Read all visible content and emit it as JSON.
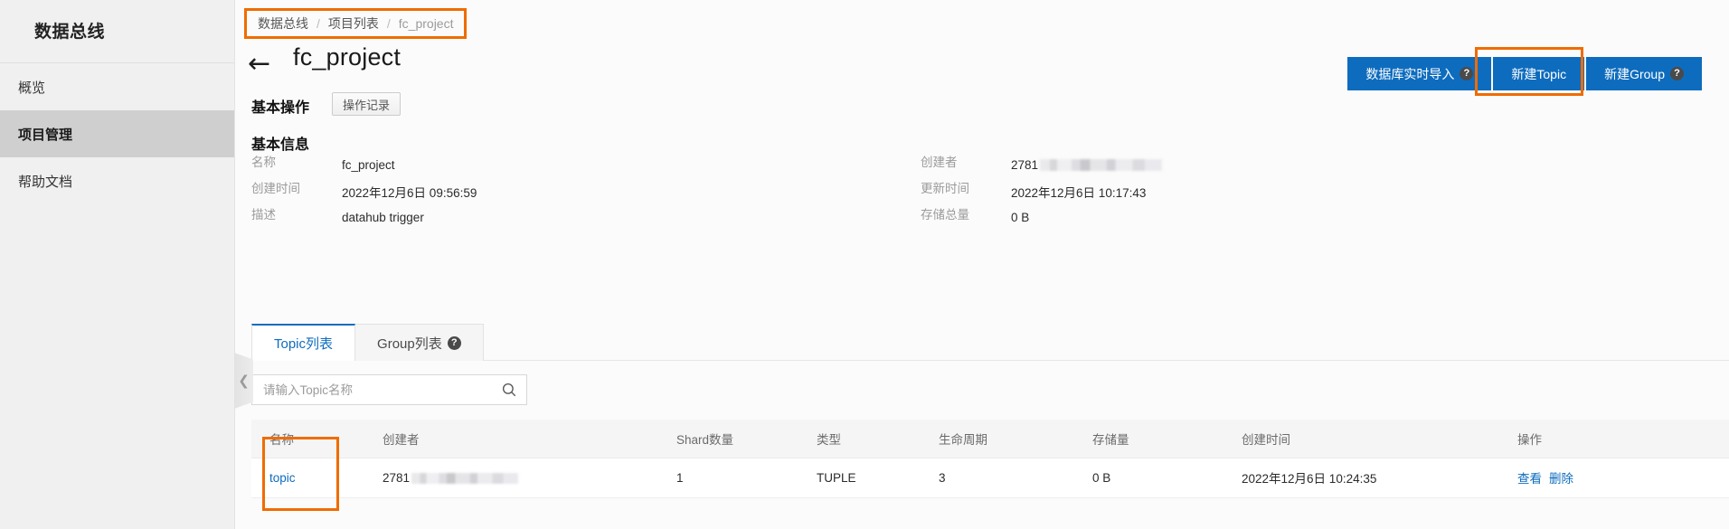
{
  "sidebar": {
    "title": "数据总线",
    "items": [
      {
        "label": "概览",
        "active": false
      },
      {
        "label": "项目管理",
        "active": true
      },
      {
        "label": "帮助文档",
        "active": false
      }
    ],
    "collapse_icon": "chevron-left-icon"
  },
  "breadcrumb": {
    "items": [
      "数据总线",
      "项目列表",
      "fc_project"
    ],
    "separator": "/"
  },
  "header": {
    "back_icon": "←",
    "title": "fc_project"
  },
  "top_actions": [
    {
      "label": "数据库实时导入",
      "help": "?",
      "has_help": true
    },
    {
      "label": "新建Topic",
      "help": "",
      "has_help": false
    },
    {
      "label": "新建Group",
      "help": "?",
      "has_help": true
    }
  ],
  "basic_ops": {
    "title": "基本操作",
    "record_button": "操作记录"
  },
  "basic_info": {
    "title": "基本信息",
    "rows": [
      {
        "l_label": "名称",
        "l_value": "fc_project",
        "r_label": "创建者",
        "r_value": "2781",
        "r_masked": true
      },
      {
        "l_label": "创建时间",
        "l_value": "2022年12月6日 09:56:59",
        "r_label": "更新时间",
        "r_value": "2022年12月6日 10:17:43",
        "r_masked": false
      },
      {
        "l_label": "描述",
        "l_value": "datahub trigger",
        "r_label": "存储总量",
        "r_value": "0 B",
        "r_masked": false
      }
    ]
  },
  "tabs": [
    {
      "label": "Topic列表",
      "active": true,
      "has_help": false
    },
    {
      "label": "Group列表",
      "active": false,
      "has_help": true,
      "help": "?"
    }
  ],
  "search": {
    "placeholder": "请输入Topic名称",
    "value": "",
    "icon": "search-icon"
  },
  "table": {
    "columns": [
      "名称",
      "创建者",
      "Shard数量",
      "类型",
      "生命周期",
      "存储量",
      "创建时间",
      "操作"
    ],
    "rows": [
      {
        "name": "topic",
        "creator": "2781",
        "creator_masked": true,
        "shard_count": "1",
        "type": "TUPLE",
        "lifecycle": "3",
        "storage": "0 B",
        "created_at": "2022年12月6日 10:24:35",
        "actions": [
          "查看",
          "删除"
        ]
      }
    ]
  },
  "highlights": {
    "color": "#ef6c00",
    "boxes": [
      "breadcrumb",
      "new-topic-button",
      "name-column"
    ]
  },
  "colors": {
    "accent": "#0e6cbe",
    "highlight": "#ef6c00",
    "sidebar_bg": "#f0f0f0",
    "sidebar_active": "#cfcfcf"
  }
}
